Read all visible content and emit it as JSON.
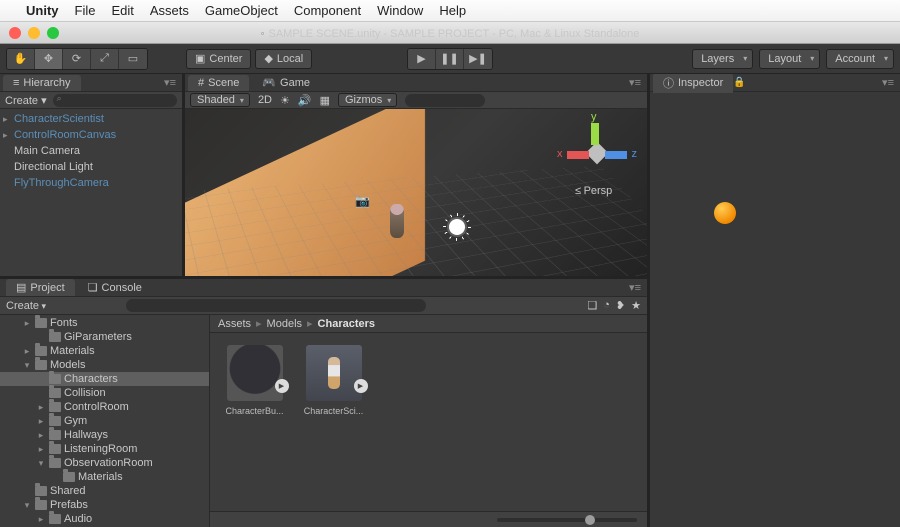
{
  "menubar": {
    "items": [
      "Unity",
      "File",
      "Edit",
      "Assets",
      "GameObject",
      "Component",
      "Window",
      "Help"
    ]
  },
  "title": "SAMPLE SCENE.unity - SAMPLE PROJECT - PC, Mac & Linux Standalone",
  "toolbar": {
    "pivot_center": "Center",
    "pivot_local": "Local",
    "layers": "Layers",
    "layout": "Layout",
    "account": "Account"
  },
  "hierarchy": {
    "tab": "Hierarchy",
    "create": "Create",
    "search_placeholder": "All",
    "items": [
      {
        "label": "CharacterScientist",
        "blue": true,
        "expand": true
      },
      {
        "label": "ControlRoomCanvas",
        "blue": true,
        "expand": true
      },
      {
        "label": "Main Camera",
        "blue": false,
        "expand": false
      },
      {
        "label": "Directional Light",
        "blue": false,
        "expand": false
      },
      {
        "label": "FlyThroughCamera",
        "blue": true,
        "expand": false
      }
    ]
  },
  "scene": {
    "tab_scene": "Scene",
    "tab_game": "Game",
    "shading": "Shaded",
    "mode_2d": "2D",
    "gizmos": "Gizmos",
    "search_placeholder": "All",
    "persp": "Persp",
    "persp_prefix": "≤"
  },
  "project": {
    "tab_project": "Project",
    "tab_console": "Console",
    "create": "Create",
    "breadcrumb": [
      "Assets",
      "Models",
      "Characters"
    ],
    "tree": [
      {
        "label": "Fonts",
        "depth": 1,
        "open": true
      },
      {
        "label": "GiParameters",
        "depth": 2,
        "open": false
      },
      {
        "label": "Materials",
        "depth": 1,
        "open": true
      },
      {
        "label": "Models",
        "depth": 1,
        "open": true,
        "expanded": true
      },
      {
        "label": "Characters",
        "depth": 2,
        "open": false,
        "selected": true
      },
      {
        "label": "Collision",
        "depth": 2,
        "open": false
      },
      {
        "label": "ControlRoom",
        "depth": 2,
        "open": true
      },
      {
        "label": "Gym",
        "depth": 2,
        "open": true
      },
      {
        "label": "Hallways",
        "depth": 2,
        "open": true
      },
      {
        "label": "ListeningRoom",
        "depth": 2,
        "open": true
      },
      {
        "label": "ObservationRoom",
        "depth": 2,
        "open": true,
        "expanded": true
      },
      {
        "label": "Materials",
        "depth": 3,
        "open": false
      },
      {
        "label": "Shared",
        "depth": 1,
        "open": false
      },
      {
        "label": "Prefabs",
        "depth": 1,
        "open": true,
        "expanded": true
      },
      {
        "label": "Audio",
        "depth": 2,
        "open": true
      }
    ],
    "assets": [
      {
        "label": "CharacterBu...",
        "kind": "bust"
      },
      {
        "label": "CharacterSci...",
        "kind": "char"
      }
    ]
  },
  "inspector": {
    "tab": "Inspector"
  }
}
